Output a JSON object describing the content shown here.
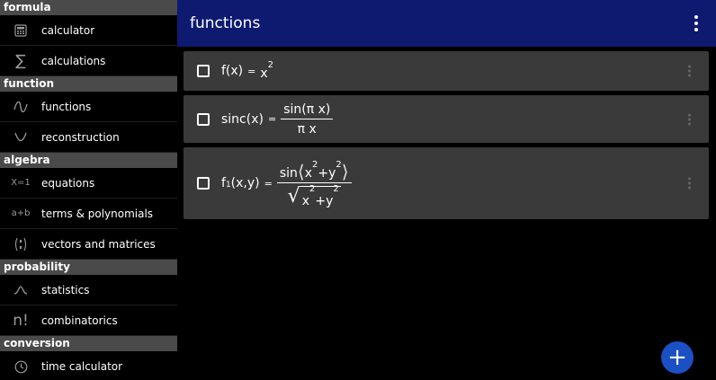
{
  "sidebar": {
    "sections": [
      {
        "header": "formula",
        "items": [
          {
            "label": "calculator",
            "icon": "calculator-icon"
          },
          {
            "label": "calculations",
            "icon": "sigma-icon"
          }
        ]
      },
      {
        "header": "function",
        "items": [
          {
            "label": "functions",
            "icon": "wave-icon"
          },
          {
            "label": "reconstruction",
            "icon": "curve-icon"
          }
        ]
      },
      {
        "header": "algebra",
        "items": [
          {
            "label": "equations",
            "icon": "equation-icon"
          },
          {
            "label": "terms & polynomials",
            "icon": "terms-icon"
          },
          {
            "label": "vectors and matrices",
            "icon": "vector-icon"
          }
        ]
      },
      {
        "header": "probability",
        "items": [
          {
            "label": "statistics",
            "icon": "bell-curve-icon"
          },
          {
            "label": "combinatorics",
            "icon": "factorial-icon"
          }
        ]
      },
      {
        "header": "conversion",
        "items": [
          {
            "label": "time calculator",
            "icon": "clock-icon"
          }
        ]
      }
    ],
    "icon_glyphs": {
      "sigma": "∑",
      "equation": "X=1",
      "terms": "a+b",
      "factorial": "n!"
    }
  },
  "appbar": {
    "title": "functions",
    "bg": "#0d1a6f"
  },
  "functions": [
    {
      "name": "f(x)",
      "eq": "=",
      "expr": {
        "base": "x",
        "exp": "2"
      }
    },
    {
      "name": "sinc(x)",
      "eq": "=",
      "num": "sin(π x)",
      "den": "π x"
    },
    {
      "name_base": "f",
      "name_sub": "1",
      "name_args": "(x,y)",
      "eq": "=",
      "num": {
        "fn": "sin",
        "a": "x",
        "a_exp": "2",
        "op": "+",
        "b": "y",
        "b_exp": "2"
      },
      "den": {
        "a": "x",
        "a_exp": "2",
        "op": "+",
        "b": "y",
        "b_exp": "2"
      }
    }
  ],
  "fab": {
    "symbol": "+",
    "color": "#1b4fc4"
  }
}
